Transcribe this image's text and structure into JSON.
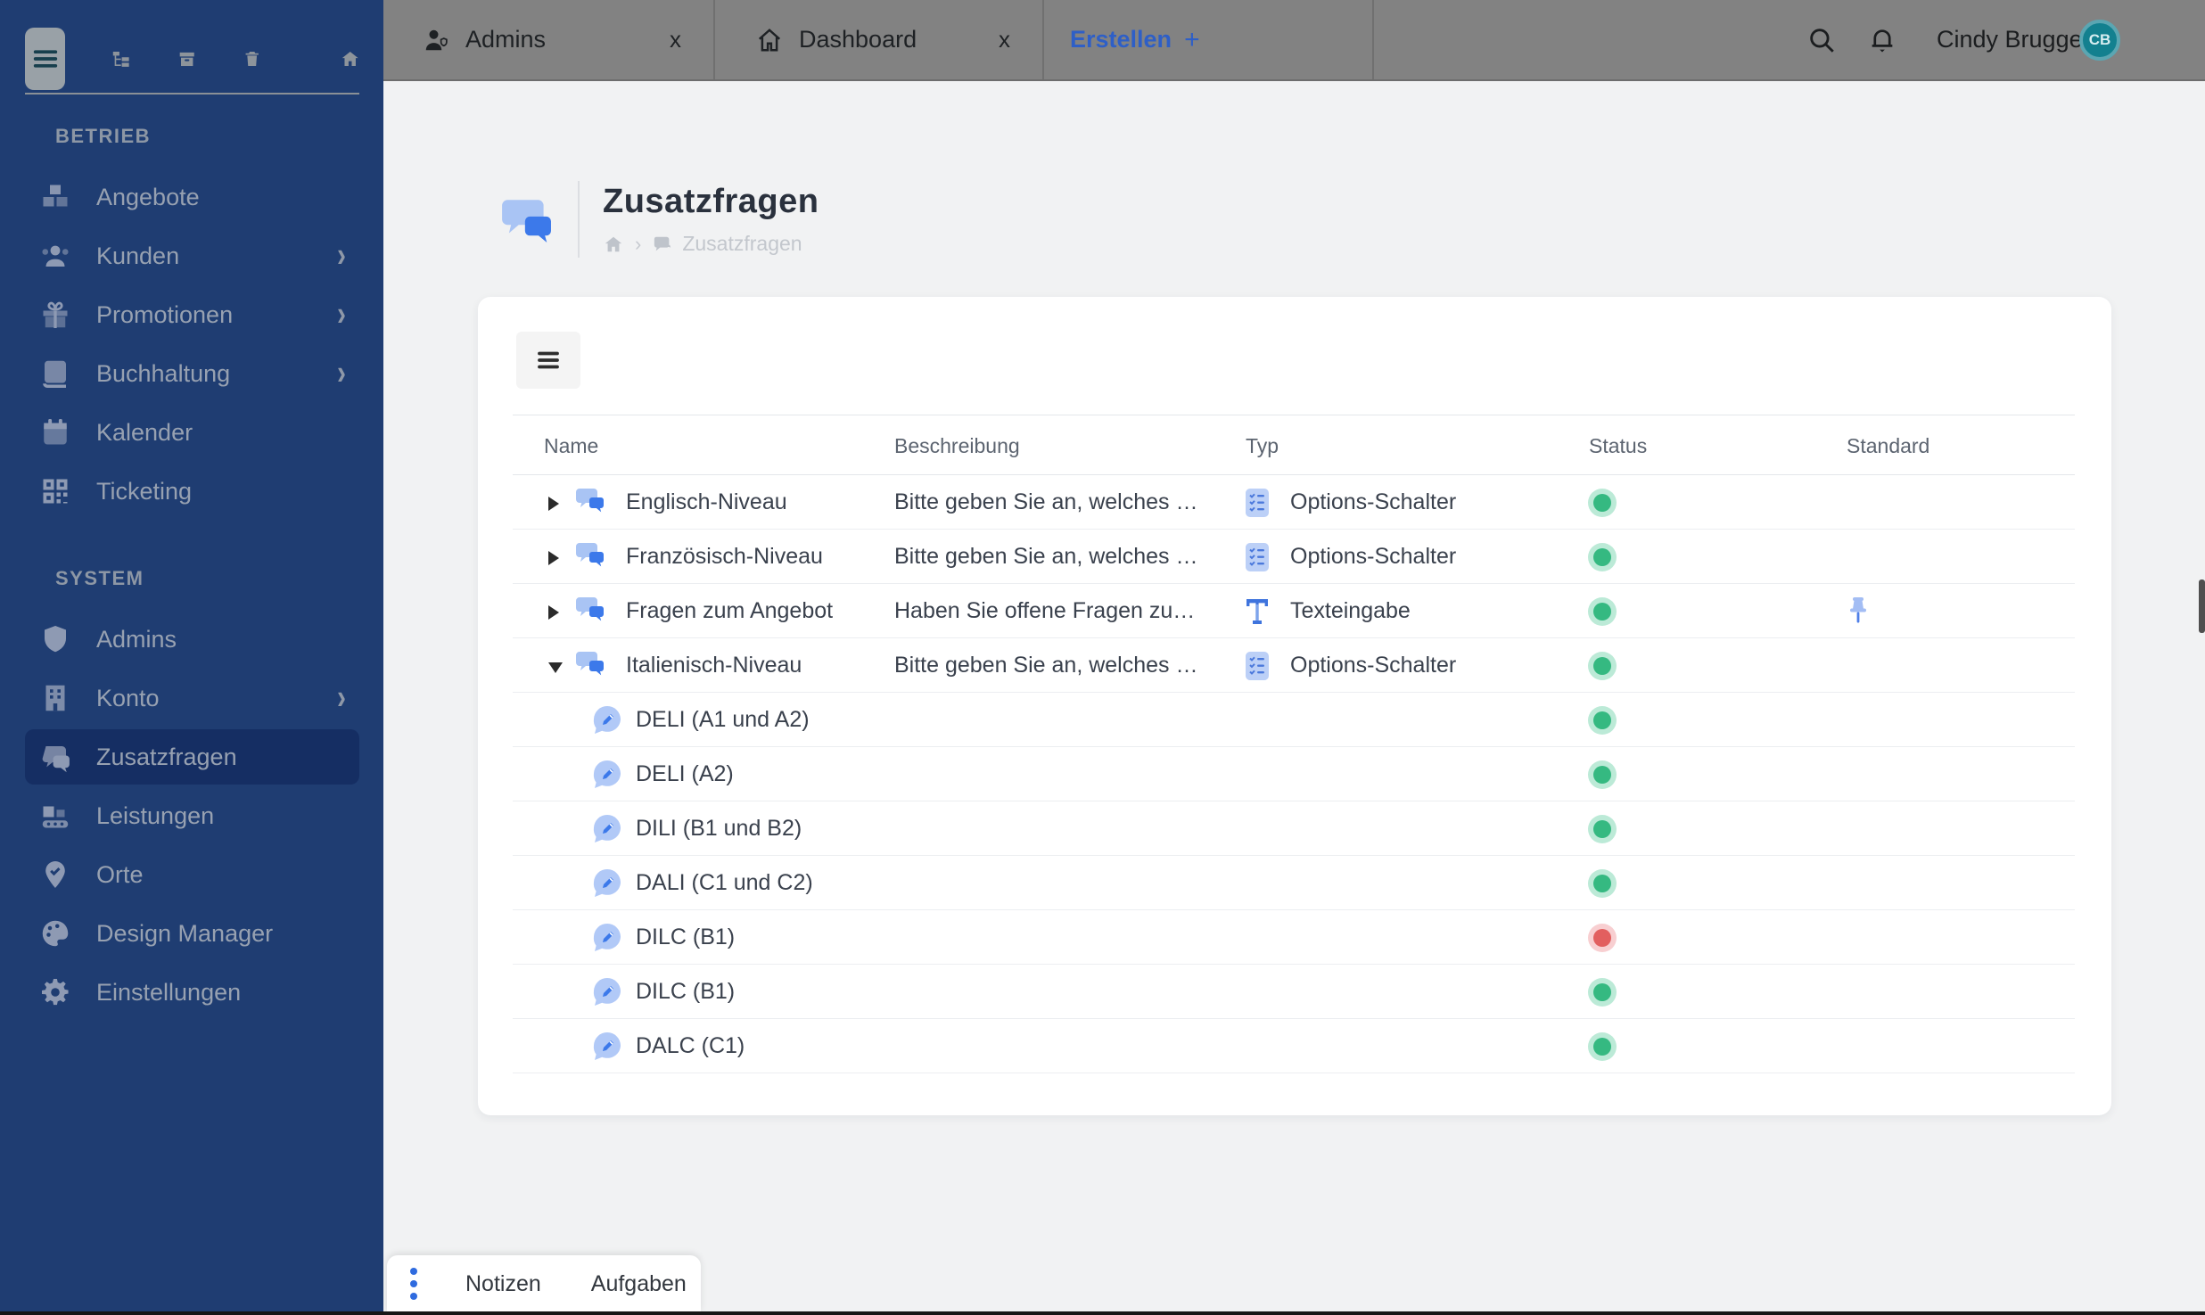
{
  "colors": {
    "sidebar_bg": "#1f3d72",
    "sidebar_active_bg": "#152e63",
    "topbar_bg": "#828282",
    "accent_blue": "#2e5fc7",
    "status_green": "#35b981",
    "status_red": "#e25f5f",
    "avatar_teal": "#13808f",
    "card_bg": "#ffffff",
    "content_bg": "#f1f2f3"
  },
  "sidebar": {
    "header_icons": [
      {
        "name": "menu-icon"
      },
      {
        "name": "tree-icon"
      },
      {
        "name": "archive-icon"
      },
      {
        "name": "trash-icon"
      },
      {
        "name": "home-icon"
      }
    ],
    "sections": [
      {
        "label": "BETRIEB",
        "items": [
          {
            "label": "Angebote",
            "icon": "cubes",
            "chevron": false,
            "active": false
          },
          {
            "label": "Kunden",
            "icon": "users",
            "chevron": true,
            "active": false
          },
          {
            "label": "Promotionen",
            "icon": "gift",
            "chevron": true,
            "active": false
          },
          {
            "label": "Buchhaltung",
            "icon": "book",
            "chevron": true,
            "active": false
          },
          {
            "label": "Kalender",
            "icon": "calendar",
            "chevron": false,
            "active": false
          },
          {
            "label": "Ticketing",
            "icon": "qr",
            "chevron": false,
            "active": false
          }
        ]
      },
      {
        "label": "SYSTEM",
        "items": [
          {
            "label": "Admins",
            "icon": "shield",
            "chevron": false,
            "active": false
          },
          {
            "label": "Konto",
            "icon": "building",
            "chevron": true,
            "active": false
          },
          {
            "label": "Zusatzfragen",
            "icon": "chat",
            "chevron": false,
            "active": true
          },
          {
            "label": "Leistungen",
            "icon": "conveyor",
            "chevron": false,
            "active": false
          },
          {
            "label": "Orte",
            "icon": "mappin",
            "chevron": false,
            "active": false
          },
          {
            "label": "Design Manager",
            "icon": "palette",
            "chevron": false,
            "active": false
          },
          {
            "label": "Einstellungen",
            "icon": "gear",
            "chevron": false,
            "active": false
          }
        ]
      }
    ]
  },
  "topbar": {
    "tabs": [
      {
        "label": "Admins",
        "icon": "user",
        "close_label": "x"
      },
      {
        "label": "Dashboard",
        "icon": "home",
        "close_label": "x"
      }
    ],
    "new_tab": {
      "label": "Erstellen",
      "plus": "+"
    },
    "user": {
      "name": "Cindy Brugger",
      "initials": "CB"
    }
  },
  "page": {
    "title": "Zusatzfragen",
    "breadcrumb": {
      "chevron": "›",
      "current": "Zusatzfragen"
    }
  },
  "table": {
    "columns": [
      "Name",
      "Beschreibung",
      "Typ",
      "Status",
      "Standard"
    ],
    "rows": [
      {
        "level": 0,
        "expanded": false,
        "name": "Englisch-Niveau",
        "description": "Bitte geben Sie an, welches …",
        "type": "Options-Schalter",
        "type_icon": "checklist",
        "status": "active",
        "standard": false
      },
      {
        "level": 0,
        "expanded": false,
        "name": "Französisch-Niveau",
        "description": "Bitte geben Sie an, welches …",
        "type": "Options-Schalter",
        "type_icon": "checklist",
        "status": "active",
        "standard": false
      },
      {
        "level": 0,
        "expanded": false,
        "name": "Fragen zum Angebot",
        "description": "Haben Sie offene Fragen zu…",
        "type": "Texteingabe",
        "type_icon": "text",
        "status": "active",
        "standard": true
      },
      {
        "level": 0,
        "expanded": true,
        "name": "Italienisch-Niveau",
        "description": "Bitte geben Sie an, welches …",
        "type": "Options-Schalter",
        "type_icon": "checklist",
        "status": "active",
        "standard": false
      },
      {
        "level": 1,
        "name": "DELI (A1 und A2)",
        "status": "active"
      },
      {
        "level": 1,
        "name": "DELI (A2)",
        "status": "active"
      },
      {
        "level": 1,
        "name": "DILI (B1 und B2)",
        "status": "active"
      },
      {
        "level": 1,
        "name": "DALI (C1 und C2)",
        "status": "active"
      },
      {
        "level": 1,
        "name": "DILC (B1)",
        "status": "inactive"
      },
      {
        "level": 1,
        "name": "DILC (B1)",
        "status": "active"
      },
      {
        "level": 1,
        "name": "DALC (C1)",
        "status": "active"
      }
    ]
  },
  "bottombar": {
    "items": [
      "Notizen",
      "Aufgaben"
    ]
  }
}
